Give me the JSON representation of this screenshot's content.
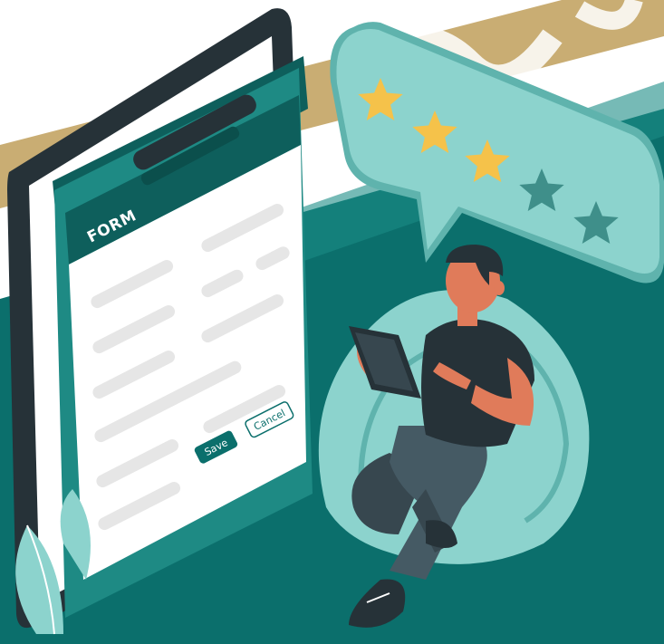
{
  "form": {
    "title": "FORM",
    "save_label": "Save",
    "cancel_label": "Cancel"
  },
  "rating": {
    "value": 3,
    "max": 5,
    "filled_color": "#f5c24a",
    "empty_color": "#3f8f8a"
  },
  "colors": {
    "teal_dark": "#0b6f6c",
    "teal_mid": "#1e8a84",
    "teal_light": "#8cd3cd",
    "gold": "#c9ad73",
    "phone": "#263238"
  },
  "icons": [
    "star-icon",
    "leaf-icon",
    "tablet-icon"
  ]
}
